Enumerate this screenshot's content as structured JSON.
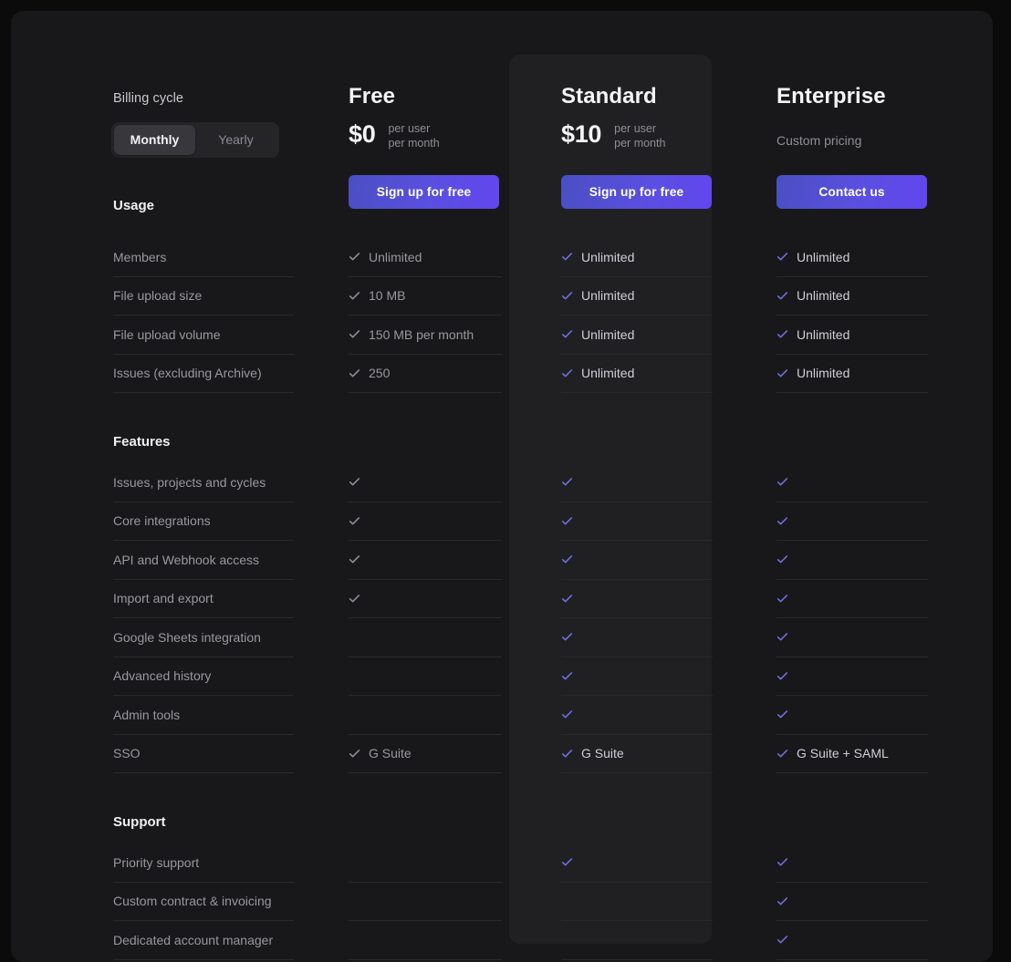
{
  "billing": {
    "label": "Billing cycle",
    "options": [
      {
        "label": "Monthly",
        "selected": true
      },
      {
        "label": "Yearly",
        "selected": false
      }
    ]
  },
  "sections": [
    {
      "title": "Usage"
    },
    {
      "title": "Features"
    },
    {
      "title": "Support"
    }
  ],
  "plans": [
    {
      "name": "Free",
      "price": "$0",
      "price_sub_line1": "per user",
      "price_sub_line2": "per month",
      "custom_pricing": "",
      "cta": "Sign up for free",
      "featured": false,
      "accent": "#8f8f98"
    },
    {
      "name": "Standard",
      "price": "$10",
      "price_sub_line1": "per user",
      "price_sub_line2": "per month",
      "custom_pricing": "",
      "cta": "Sign up for free",
      "featured": true,
      "accent": "#6f6fe0"
    },
    {
      "name": "Enterprise",
      "price": "",
      "price_sub_line1": "",
      "price_sub_line2": "",
      "custom_pricing": "Custom pricing",
      "cta": "Contact us",
      "featured": false,
      "accent": "#6f6fe0"
    }
  ],
  "usage": {
    "title": "Usage",
    "rows": [
      {
        "label": "Members",
        "free": {
          "check": true,
          "text": "Unlimited"
        },
        "std": {
          "check": true,
          "text": "Unlimited"
        },
        "ent": {
          "check": true,
          "text": "Unlimited"
        }
      },
      {
        "label": "File upload size",
        "free": {
          "check": true,
          "text": "10 MB"
        },
        "std": {
          "check": true,
          "text": "Unlimited"
        },
        "ent": {
          "check": true,
          "text": "Unlimited"
        }
      },
      {
        "label": "File upload volume",
        "free": {
          "check": true,
          "text": "150 MB per month"
        },
        "std": {
          "check": true,
          "text": "Unlimited"
        },
        "ent": {
          "check": true,
          "text": "Unlimited"
        }
      },
      {
        "label": "Issues (excluding Archive)",
        "free": {
          "check": true,
          "text": "250"
        },
        "std": {
          "check": true,
          "text": "Unlimited"
        },
        "ent": {
          "check": true,
          "text": "Unlimited"
        }
      }
    ]
  },
  "features": {
    "title": "Features",
    "rows": [
      {
        "label": "Issues, projects and cycles",
        "free": {
          "check": true,
          "text": ""
        },
        "std": {
          "check": true,
          "text": ""
        },
        "ent": {
          "check": true,
          "text": ""
        }
      },
      {
        "label": "Core integrations",
        "free": {
          "check": true,
          "text": ""
        },
        "std": {
          "check": true,
          "text": ""
        },
        "ent": {
          "check": true,
          "text": ""
        }
      },
      {
        "label": "API and Webhook access",
        "free": {
          "check": true,
          "text": ""
        },
        "std": {
          "check": true,
          "text": ""
        },
        "ent": {
          "check": true,
          "text": ""
        }
      },
      {
        "label": "Import and export",
        "free": {
          "check": true,
          "text": ""
        },
        "std": {
          "check": true,
          "text": ""
        },
        "ent": {
          "check": true,
          "text": ""
        }
      },
      {
        "label": "Google Sheets integration",
        "free": {
          "check": false,
          "text": ""
        },
        "std": {
          "check": true,
          "text": ""
        },
        "ent": {
          "check": true,
          "text": ""
        }
      },
      {
        "label": "Advanced history",
        "free": {
          "check": false,
          "text": ""
        },
        "std": {
          "check": true,
          "text": ""
        },
        "ent": {
          "check": true,
          "text": ""
        }
      },
      {
        "label": "Admin tools",
        "free": {
          "check": false,
          "text": ""
        },
        "std": {
          "check": true,
          "text": ""
        },
        "ent": {
          "check": true,
          "text": ""
        }
      },
      {
        "label": "SSO",
        "free": {
          "check": true,
          "text": "G Suite"
        },
        "std": {
          "check": true,
          "text": "G Suite"
        },
        "ent": {
          "check": true,
          "text": "G Suite + SAML"
        }
      }
    ]
  },
  "support": {
    "title": "Support",
    "rows": [
      {
        "label": "Priority support",
        "free": {
          "check": false,
          "text": ""
        },
        "std": {
          "check": true,
          "text": ""
        },
        "ent": {
          "check": true,
          "text": ""
        }
      },
      {
        "label": "Custom contract & invoicing",
        "free": {
          "check": false,
          "text": ""
        },
        "std": {
          "check": false,
          "text": ""
        },
        "ent": {
          "check": true,
          "text": ""
        }
      },
      {
        "label": "Dedicated account manager",
        "free": {
          "check": false,
          "text": ""
        },
        "std": {
          "check": false,
          "text": ""
        },
        "ent": {
          "check": true,
          "text": ""
        }
      }
    ]
  },
  "colors": {
    "page_background": "#0b0b0c",
    "panel_background": "#18181a",
    "featured_card": "#202023",
    "accent": "#6246ef",
    "accent_check": "#6f6fe0",
    "muted_check": "#8f8f98",
    "divider": "#2a2a2e"
  }
}
